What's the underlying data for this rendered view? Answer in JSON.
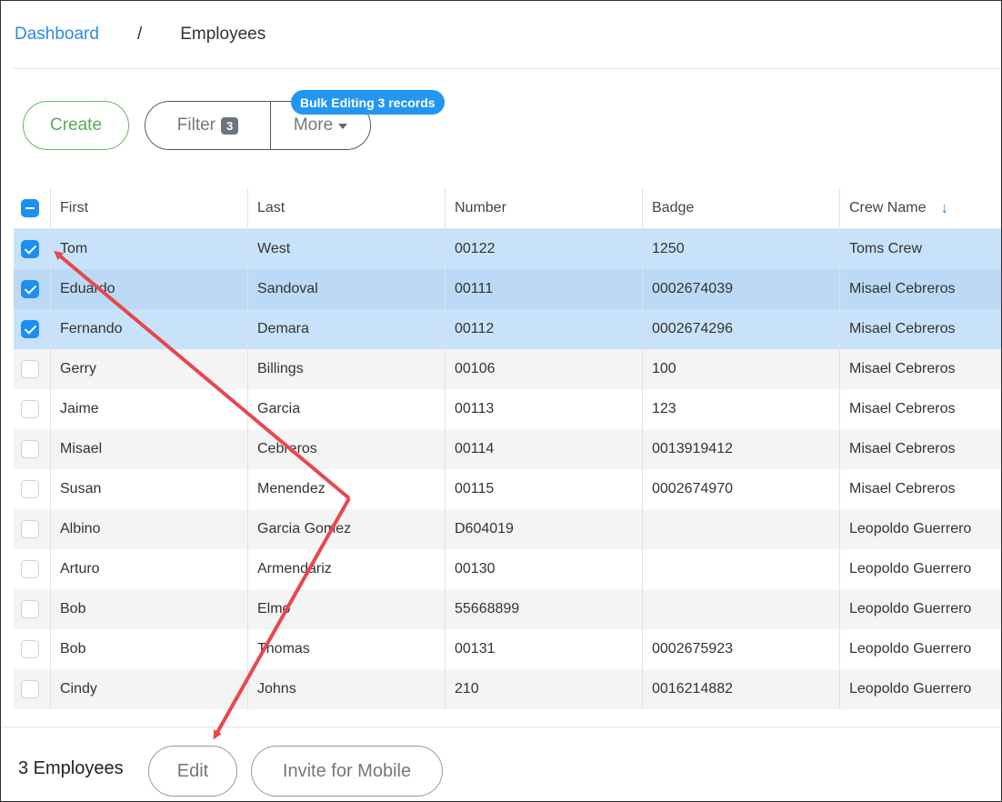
{
  "breadcrumb": {
    "dashboard": "Dashboard",
    "separator": "/",
    "current": "Employees"
  },
  "toolbar": {
    "create_label": "Create",
    "filter_label": "Filter",
    "filter_count": "3",
    "more_label": "More",
    "bulk_badge": "Bulk Editing 3 records"
  },
  "table": {
    "columns": {
      "first": "First",
      "last": "Last",
      "number": "Number",
      "badge": "Badge",
      "crew": "Crew Name"
    },
    "sort_icon": "arrow-down-icon",
    "rows": [
      {
        "first": "Tom",
        "last": "West",
        "number": "00122",
        "badge": "1250",
        "crew": "Toms Crew",
        "checked": true
      },
      {
        "first": "Eduardo",
        "last": "Sandoval",
        "number": "00111",
        "badge": "0002674039",
        "crew": "Misael Cebreros",
        "checked": true
      },
      {
        "first": "Fernando",
        "last": "Demara",
        "number": "00112",
        "badge": "0002674296",
        "crew": "Misael Cebreros",
        "checked": true
      },
      {
        "first": "Gerry",
        "last": "Billings",
        "number": "00106",
        "badge": "100",
        "crew": "Misael Cebreros",
        "checked": false
      },
      {
        "first": "Jaime",
        "last": "Garcia",
        "number": "00113",
        "badge": "123",
        "crew": "Misael Cebreros",
        "checked": false
      },
      {
        "first": "Misael",
        "last": "Cebreros",
        "number": "00114",
        "badge": "0013919412",
        "crew": "Misael Cebreros",
        "checked": false
      },
      {
        "first": "Susan",
        "last": "Menendez",
        "number": "00115",
        "badge": "0002674970",
        "crew": "Misael Cebreros",
        "checked": false
      },
      {
        "first": "Albino",
        "last": "Garcia Gomez",
        "number": "D604019",
        "badge": "",
        "crew": "Leopoldo Guerrero",
        "checked": false
      },
      {
        "first": "Arturo",
        "last": "Armendariz",
        "number": "00130",
        "badge": "",
        "crew": "Leopoldo Guerrero",
        "checked": false
      },
      {
        "first": "Bob",
        "last": "Elmo",
        "number": "55668899",
        "badge": "",
        "crew": "Leopoldo Guerrero",
        "checked": false
      },
      {
        "first": "Bob",
        "last": "Thomas",
        "number": "00131",
        "badge": "0002675923",
        "crew": "Leopoldo Guerrero",
        "checked": false
      },
      {
        "first": "Cindy",
        "last": "Johns",
        "number": "210",
        "badge": "0016214882",
        "crew": "Leopoldo Guerrero",
        "checked": false
      }
    ]
  },
  "footer": {
    "count_label": "3 Employees",
    "edit_label": "Edit",
    "invite_label": "Invite for Mobile"
  },
  "colors": {
    "accent": "#2b8be6",
    "selected_row": "#c8e2fb",
    "create_green": "#5aa85a",
    "annotation_arrow": "#e8474c"
  }
}
